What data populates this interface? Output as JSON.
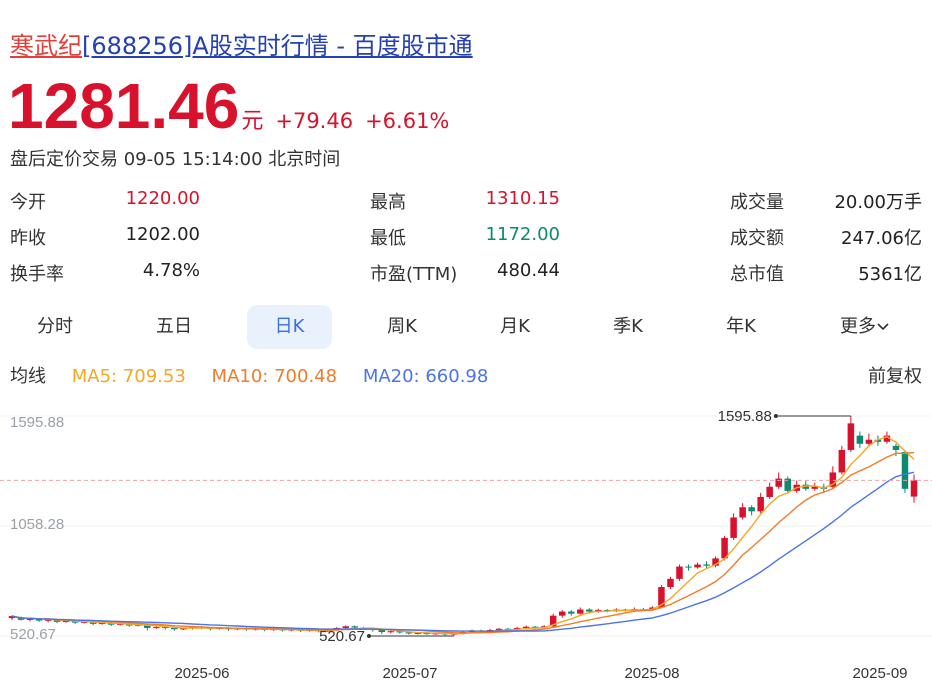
{
  "title": {
    "name": "寒武纪",
    "code_suffix": "[688256]A股实时行情 - 百度股市通"
  },
  "quote": {
    "price": "1281.46",
    "unit": "元",
    "change": "+79.46",
    "change_pct": "+6.61%"
  },
  "status_text": "盘后定价交易 09-05 15:14:00 北京时间",
  "stats": [
    {
      "label": "今开",
      "value": "1220.00",
      "tone": "up"
    },
    {
      "label": "最高",
      "value": "1310.15",
      "tone": "up"
    },
    {
      "label": "成交量",
      "value": "20.00万手",
      "tone": "neutral"
    },
    {
      "label": "昨收",
      "value": "1202.00",
      "tone": "neutral"
    },
    {
      "label": "最低",
      "value": "1172.00",
      "tone": "down"
    },
    {
      "label": "成交额",
      "value": "247.06亿",
      "tone": "neutral"
    },
    {
      "label": "换手率",
      "value": "4.78%",
      "tone": "neutral"
    },
    {
      "label": "市盈(TTM)",
      "value": "480.44",
      "tone": "neutral"
    },
    {
      "label": "总市值",
      "value": "5361亿",
      "tone": "neutral"
    }
  ],
  "tabs": [
    "分时",
    "五日",
    "日K",
    "周K",
    "月K",
    "季K",
    "年K",
    "更多"
  ],
  "active_tab": "日K",
  "ma": {
    "label": "均线",
    "ma5": "MA5: 709.53",
    "ma10": "MA10: 700.48",
    "ma20": "MA20: 660.98",
    "adjust": "前复权"
  },
  "colors": {
    "up": "#d8112c",
    "down": "#0a8a6e",
    "ma5": "#f5a623",
    "ma10": "#f07c2a",
    "ma20": "#4a74e8",
    "accent": "#3a6ee8"
  },
  "chart_data": {
    "type": "candlestick",
    "y_ticks": [
      "1595.88",
      "1058.28",
      "520.67"
    ],
    "ylim": [
      520.67,
      1595.88
    ],
    "x_ticks": [
      "2025-06",
      "2025-07",
      "2025-08",
      "2025-09"
    ],
    "max_label": "1595.88",
    "min_label": "520.67",
    "last_close": 1281.46,
    "candles": [
      [
        608,
        618,
        598,
        622
      ],
      [
        612,
        600,
        596,
        616
      ],
      [
        600,
        604,
        592,
        610
      ],
      [
        604,
        596,
        590,
        608
      ],
      [
        596,
        600,
        588,
        604
      ],
      [
        600,
        590,
        584,
        604
      ],
      [
        590,
        594,
        586,
        598
      ],
      [
        594,
        586,
        580,
        598
      ],
      [
        586,
        590,
        582,
        594
      ],
      [
        590,
        580,
        574,
        594
      ],
      [
        580,
        584,
        576,
        588
      ],
      [
        584,
        576,
        570,
        588
      ],
      [
        576,
        580,
        572,
        584
      ],
      [
        580,
        572,
        566,
        584
      ],
      [
        572,
        576,
        568,
        580
      ],
      [
        576,
        560,
        548,
        578
      ],
      [
        560,
        564,
        556,
        568
      ],
      [
        564,
        560,
        552,
        568
      ],
      [
        560,
        554,
        546,
        564
      ],
      [
        554,
        558,
        550,
        562
      ],
      [
        558,
        566,
        552,
        570
      ],
      [
        566,
        560,
        554,
        570
      ],
      [
        560,
        556,
        548,
        564
      ],
      [
        556,
        560,
        552,
        564
      ],
      [
        560,
        554,
        546,
        564
      ],
      [
        554,
        558,
        550,
        562
      ],
      [
        558,
        552,
        546,
        562
      ],
      [
        552,
        556,
        548,
        560
      ],
      [
        556,
        550,
        544,
        560
      ],
      [
        550,
        554,
        546,
        558
      ],
      [
        554,
        548,
        542,
        558
      ],
      [
        548,
        552,
        544,
        556
      ],
      [
        552,
        546,
        540,
        556
      ],
      [
        546,
        550,
        542,
        554
      ],
      [
        550,
        544,
        538,
        554
      ],
      [
        544,
        548,
        540,
        552
      ],
      [
        548,
        560,
        546,
        564
      ],
      [
        560,
        568,
        556,
        572
      ],
      [
        568,
        562,
        556,
        572
      ],
      [
        562,
        556,
        550,
        566
      ],
      [
        556,
        550,
        542,
        560
      ],
      [
        550,
        540,
        530,
        554
      ],
      [
        540,
        544,
        534,
        548
      ],
      [
        544,
        538,
        532,
        548
      ],
      [
        538,
        534,
        528,
        542
      ],
      [
        534,
        536,
        528,
        540
      ],
      [
        536,
        530,
        526,
        540
      ],
      [
        530,
        534,
        526,
        538
      ],
      [
        534,
        528,
        522,
        538
      ],
      [
        528,
        532,
        520.67,
        536
      ],
      [
        532,
        540,
        528,
        546
      ],
      [
        540,
        548,
        536,
        552
      ],
      [
        548,
        544,
        538,
        552
      ],
      [
        544,
        550,
        540,
        556
      ],
      [
        550,
        556,
        546,
        560
      ],
      [
        556,
        552,
        546,
        560
      ],
      [
        552,
        560,
        548,
        566
      ],
      [
        560,
        566,
        556,
        572
      ],
      [
        566,
        562,
        556,
        570
      ],
      [
        562,
        568,
        558,
        574
      ],
      [
        568,
        620,
        564,
        630
      ],
      [
        620,
        640,
        610,
        648
      ],
      [
        640,
        630,
        620,
        648
      ],
      [
        630,
        650,
        626,
        660
      ],
      [
        650,
        640,
        630,
        656
      ],
      [
        640,
        648,
        634,
        654
      ],
      [
        648,
        642,
        636,
        652
      ],
      [
        642,
        650,
        638,
        656
      ],
      [
        650,
        646,
        640,
        654
      ],
      [
        646,
        652,
        640,
        660
      ],
      [
        652,
        648,
        642,
        658
      ],
      [
        648,
        660,
        644,
        666
      ],
      [
        660,
        760,
        656,
        770
      ],
      [
        760,
        800,
        750,
        810
      ],
      [
        800,
        860,
        790,
        870
      ],
      [
        860,
        856,
        840,
        870
      ],
      [
        856,
        870,
        850,
        880
      ],
      [
        870,
        864,
        850,
        886
      ],
      [
        864,
        900,
        856,
        910
      ],
      [
        900,
        1000,
        890,
        1010
      ],
      [
        1000,
        1100,
        990,
        1120
      ],
      [
        1100,
        1150,
        1090,
        1170
      ],
      [
        1150,
        1130,
        1110,
        1160
      ],
      [
        1130,
        1200,
        1120,
        1220
      ],
      [
        1200,
        1250,
        1190,
        1270
      ],
      [
        1250,
        1290,
        1240,
        1320
      ],
      [
        1290,
        1230,
        1220,
        1300
      ],
      [
        1230,
        1260,
        1220,
        1280
      ],
      [
        1260,
        1240,
        1230,
        1280
      ],
      [
        1240,
        1250,
        1230,
        1270
      ],
      [
        1250,
        1240,
        1220,
        1265
      ],
      [
        1250,
        1320,
        1240,
        1350
      ],
      [
        1320,
        1430,
        1310,
        1450
      ],
      [
        1430,
        1560,
        1420,
        1595.88
      ],
      [
        1500,
        1460,
        1440,
        1520
      ],
      [
        1460,
        1480,
        1450,
        1510
      ],
      [
        1480,
        1470,
        1450,
        1500
      ],
      [
        1470,
        1500,
        1460,
        1520
      ],
      [
        1450,
        1430,
        1400,
        1460
      ],
      [
        1420,
        1240,
        1220,
        1430
      ],
      [
        1202,
        1281.46,
        1172,
        1310.15
      ]
    ]
  }
}
